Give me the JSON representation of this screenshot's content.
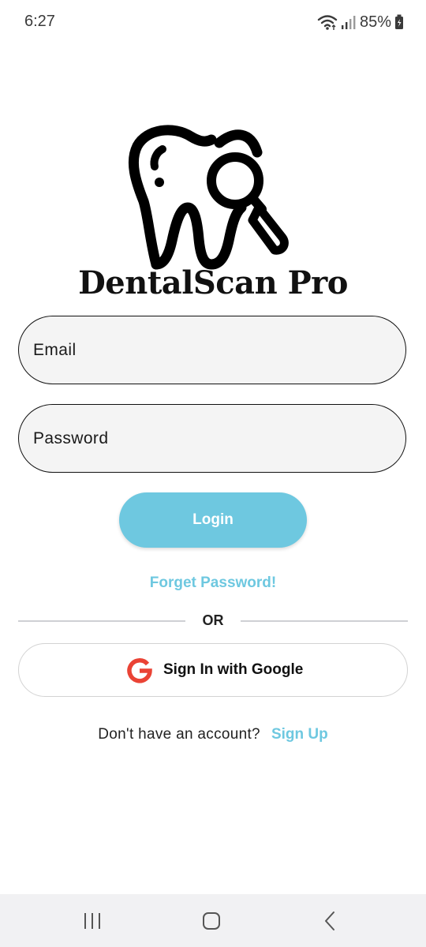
{
  "status_bar": {
    "time": "6:27",
    "battery": "85%",
    "icons": [
      "wifi-icon",
      "signal-icon",
      "battery-icon"
    ]
  },
  "logo": {
    "icon": "tooth-magnifier-icon",
    "title": "DentalScan Pro"
  },
  "form": {
    "email_placeholder": "Email",
    "password_placeholder": "Password",
    "login_label": "Login",
    "forgot_label": "Forget Password!"
  },
  "divider": {
    "text": "OR"
  },
  "google": {
    "icon": "google-icon",
    "label": "Sign In with Google"
  },
  "signup": {
    "prompt": "Don't have an account?",
    "link_label": "Sign Up"
  },
  "nav_bar": {
    "icons": [
      "recents-icon",
      "home-icon",
      "back-icon"
    ]
  },
  "colors": {
    "accent": "#6ec8e0",
    "field_bg": "#f4f4f4",
    "nav_bg": "#f1f1f3",
    "google_red": "#ea4335"
  }
}
